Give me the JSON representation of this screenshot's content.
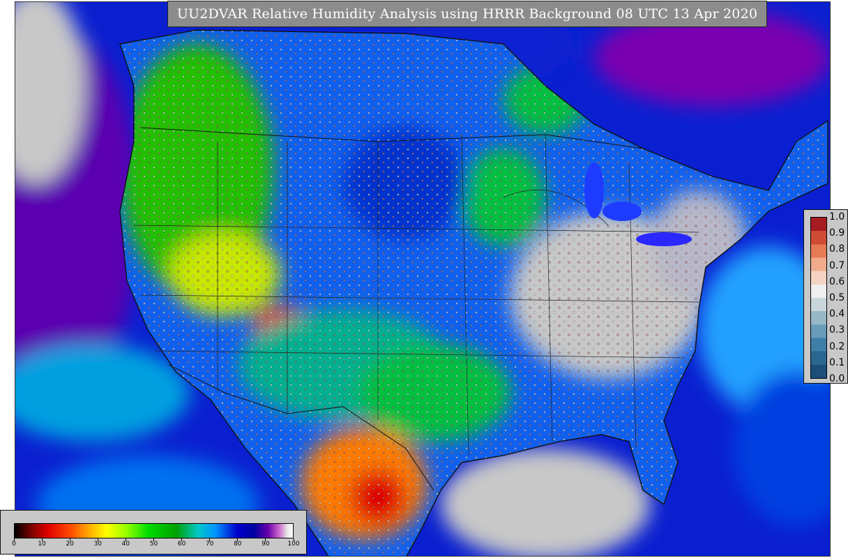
{
  "title": "UU2DVAR Relative Humidity Analysis using HRRR Background 08 UTC 13 Apr 2020",
  "map": {
    "region": "CONUS",
    "background_gray": "#c8c8c8",
    "coastline_color": "#111111",
    "border_color": "#111111"
  },
  "humidity_colorbar": {
    "tick_labels": [
      "0",
      "10",
      "20",
      "30",
      "40",
      "50",
      "60",
      "70",
      "80",
      "90",
      "100"
    ],
    "tick_values": [
      0,
      10,
      20,
      30,
      40,
      50,
      60,
      70,
      80,
      90,
      100
    ],
    "range": [
      0,
      100
    ],
    "stops": [
      {
        "value": 0,
        "color": "#000000"
      },
      {
        "value": 6,
        "color": "#7a0000"
      },
      {
        "value": 12,
        "color": "#e00000"
      },
      {
        "value": 20,
        "color": "#ff4a00"
      },
      {
        "value": 26,
        "color": "#ffa000"
      },
      {
        "value": 33,
        "color": "#ffff00"
      },
      {
        "value": 40,
        "color": "#9aff00"
      },
      {
        "value": 48,
        "color": "#00dd00"
      },
      {
        "value": 58,
        "color": "#00a000"
      },
      {
        "value": 66,
        "color": "#00c8c8"
      },
      {
        "value": 72,
        "color": "#0096ff"
      },
      {
        "value": 80,
        "color": "#0000cd"
      },
      {
        "value": 86,
        "color": "#0000a0"
      },
      {
        "value": 91,
        "color": "#6600aa"
      },
      {
        "value": 95,
        "color": "#cc66cc"
      },
      {
        "value": 98,
        "color": "#e8e8e8"
      },
      {
        "value": 100,
        "color": "#ffffff"
      }
    ]
  },
  "innovation_colorbar": {
    "tick_labels": [
      "1.0",
      "0.9",
      "0.8",
      "0.7",
      "0.6",
      "0.5",
      "0.4",
      "0.3",
      "0.2",
      "0.1",
      "0.0"
    ],
    "tick_values": [
      1.0,
      0.9,
      0.8,
      0.7,
      0.6,
      0.5,
      0.4,
      0.3,
      0.2,
      0.1,
      0.0
    ],
    "range": [
      0.0,
      1.0
    ],
    "segment_colors": [
      "#1b4f7a",
      "#2a6690",
      "#3f7ea6",
      "#679bb8",
      "#98b8c8",
      "#c9d6dc",
      "#efefef",
      "#f5d3c2",
      "#f0ab8c",
      "#e57a55",
      "#cf4b33",
      "#a61c22"
    ]
  }
}
